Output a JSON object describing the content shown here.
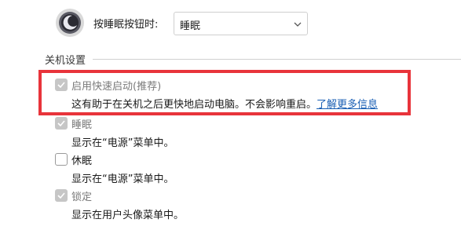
{
  "sleep_button": {
    "label": "按睡眠按钮时:",
    "selected": "睡眠"
  },
  "shutdown_settings": {
    "title": "关机设置",
    "options": [
      {
        "label": "启用快速启动(推荐)",
        "description": "这有助于在关机之后更快地启动电脑。不会影响重启。",
        "link": "了解更多信息",
        "checked": true,
        "enabled": false
      },
      {
        "label": "睡眠",
        "description": "显示在“电源”菜单中。",
        "checked": true,
        "enabled": false
      },
      {
        "label": "休眠",
        "description": "显示在“电源”菜单中。",
        "checked": false,
        "enabled": true
      },
      {
        "label": "锁定",
        "description": "显示在用户头像菜单中。",
        "checked": true,
        "enabled": false
      }
    ]
  },
  "colors": {
    "highlight_border": "#e8343b",
    "link": "#1a5fb4",
    "disabled_check": "#c6c6c6"
  },
  "icons": {
    "power": "sleep-moon-icon",
    "dropdown": "chevron-down-icon",
    "check": "check-icon"
  }
}
